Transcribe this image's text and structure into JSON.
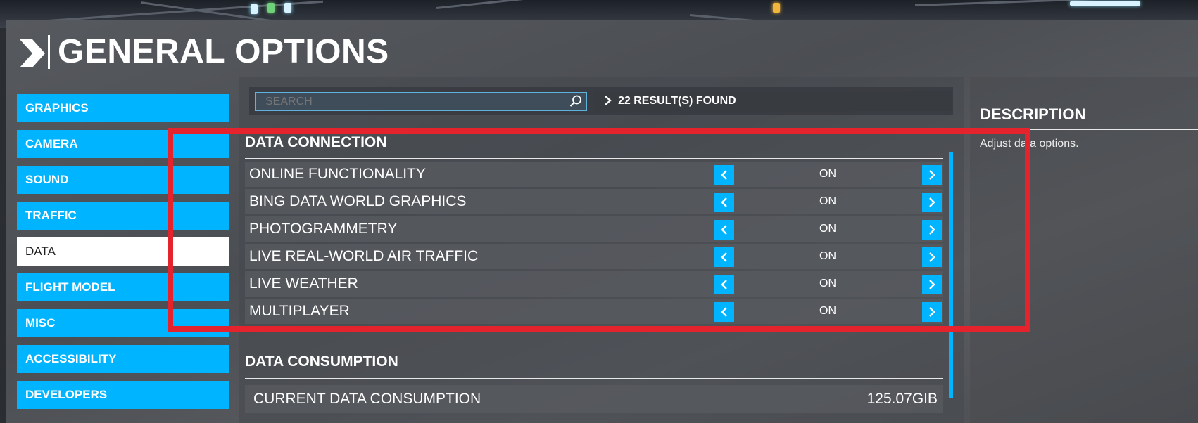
{
  "header": {
    "title": "GENERAL OPTIONS"
  },
  "menu": {
    "items": [
      {
        "label": "GRAPHICS",
        "active": false
      },
      {
        "label": "CAMERA",
        "active": false
      },
      {
        "label": "SOUND",
        "active": false
      },
      {
        "label": "TRAFFIC",
        "active": false
      },
      {
        "label": "DATA",
        "active": true
      },
      {
        "label": "FLIGHT MODEL",
        "active": false
      },
      {
        "label": "MISC",
        "active": false
      },
      {
        "label": "ACCESSIBILITY",
        "active": false
      },
      {
        "label": "DEVELOPERS",
        "active": false
      }
    ]
  },
  "search": {
    "placeholder": "SEARCH",
    "results": "22 RESULT(S) FOUND"
  },
  "sections": {
    "data_connection": {
      "title": "DATA CONNECTION",
      "rows": [
        {
          "label": "ONLINE FUNCTIONALITY",
          "value": "ON"
        },
        {
          "label": "BING DATA WORLD GRAPHICS",
          "value": "ON"
        },
        {
          "label": "PHOTOGRAMMETRY",
          "value": "ON"
        },
        {
          "label": "LIVE REAL-WORLD AIR TRAFFIC",
          "value": "ON"
        },
        {
          "label": "LIVE WEATHER",
          "value": "ON"
        },
        {
          "label": "MULTIPLAYER",
          "value": "ON"
        }
      ]
    },
    "data_consumption": {
      "title": "DATA CONSUMPTION",
      "rows": [
        {
          "label": "CURRENT DATA CONSUMPTION",
          "value": "125.07GIB"
        }
      ]
    }
  },
  "description": {
    "title": "DESCRIPTION",
    "text": "Adjust data options."
  },
  "colors": {
    "accent": "#00b4ff",
    "highlight": "#e5232c",
    "active_menu": "#ffffff"
  }
}
